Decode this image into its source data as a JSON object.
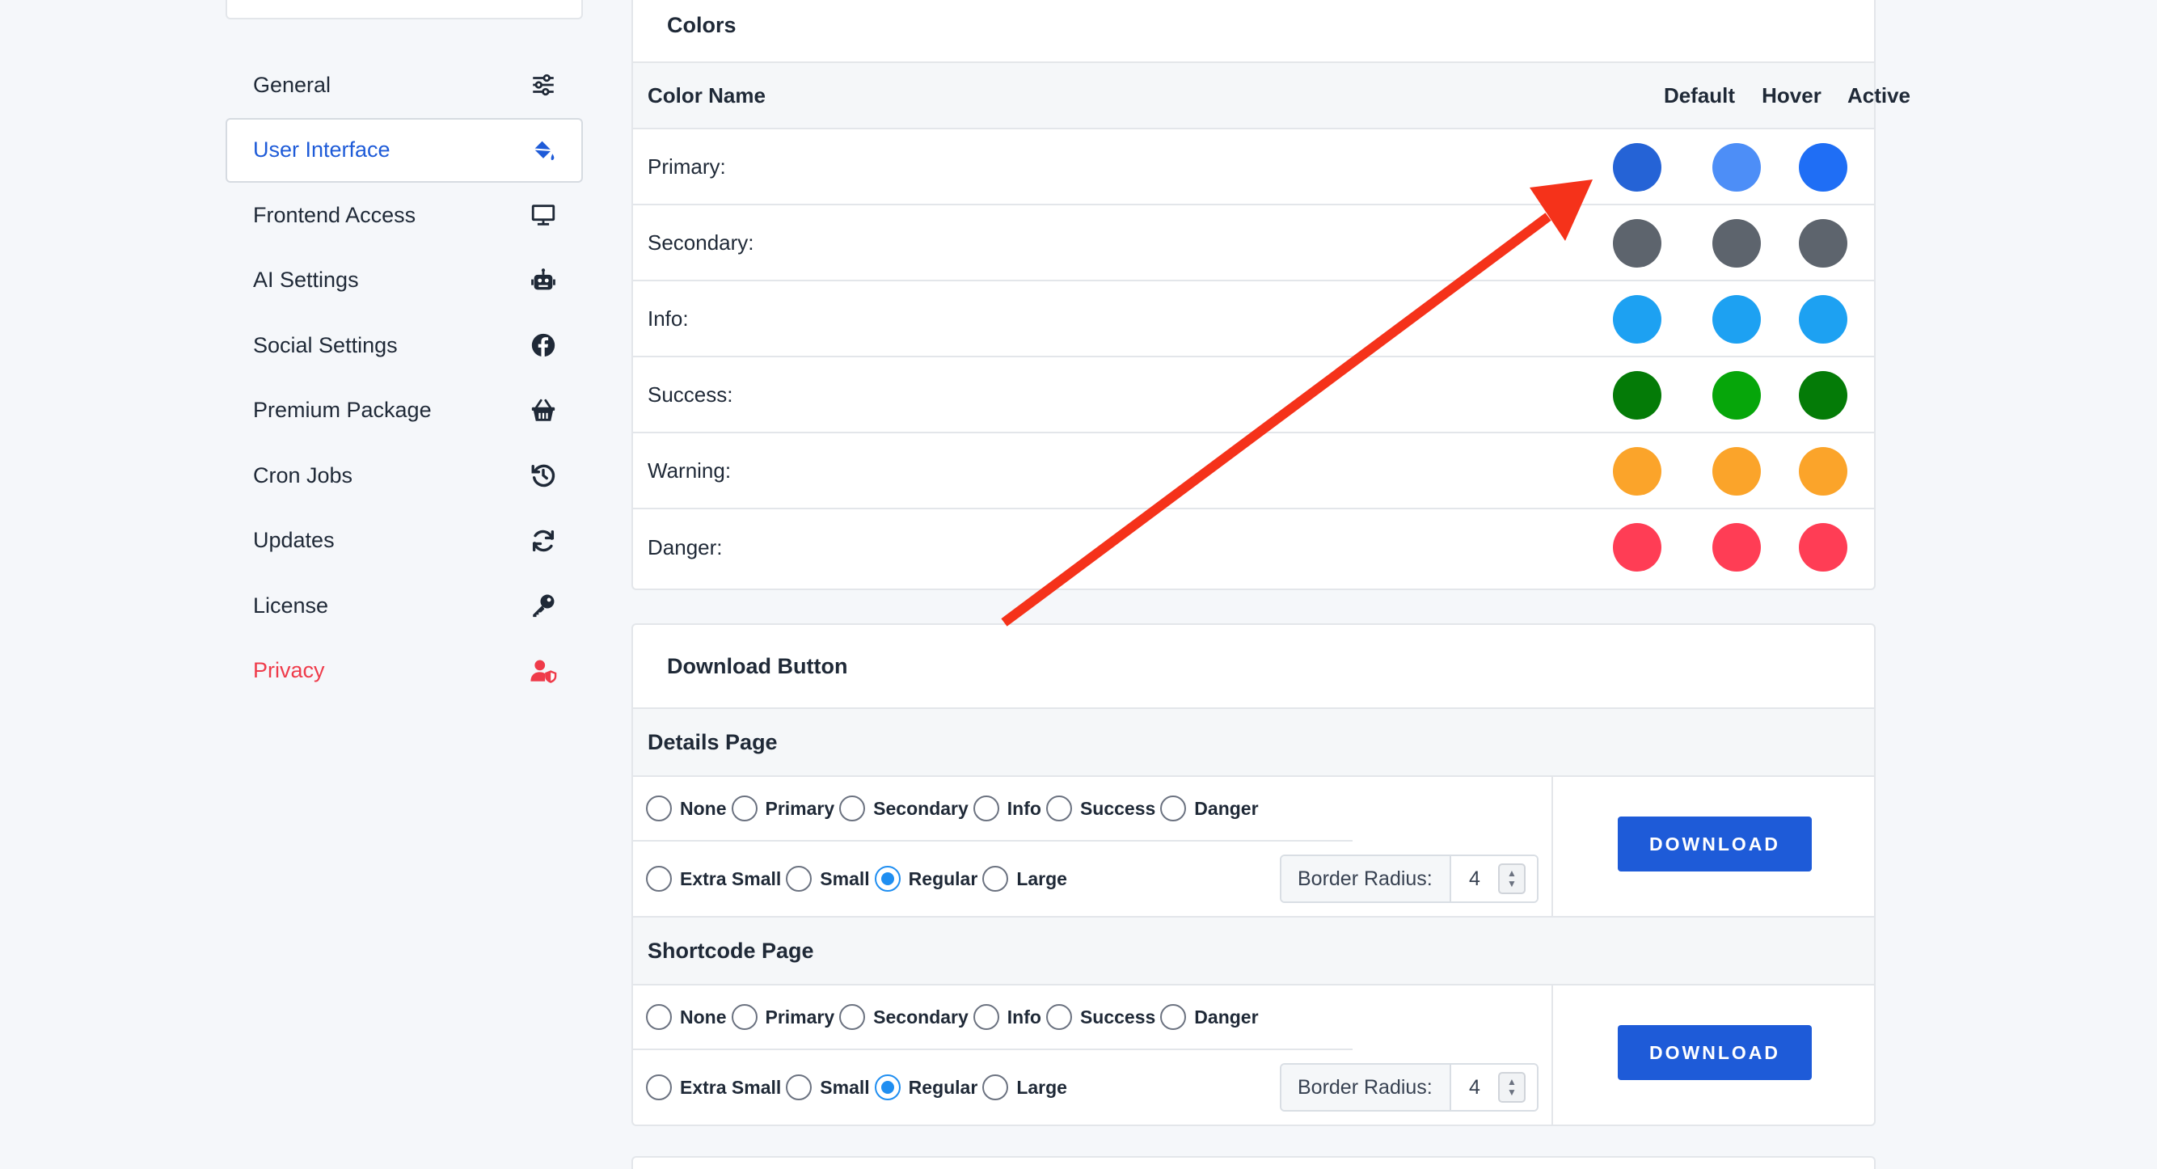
{
  "sidebar": {
    "items": [
      {
        "label": "General",
        "icon": "sliders-icon",
        "active": false,
        "danger": false
      },
      {
        "label": "User Interface",
        "icon": "paint-bucket-icon",
        "active": true,
        "danger": false
      },
      {
        "label": "Frontend Access",
        "icon": "monitor-icon",
        "active": false,
        "danger": false
      },
      {
        "label": "AI Settings",
        "icon": "robot-icon",
        "active": false,
        "danger": false
      },
      {
        "label": "Social Settings",
        "icon": "facebook-icon",
        "active": false,
        "danger": false
      },
      {
        "label": "Premium Package",
        "icon": "basket-icon",
        "active": false,
        "danger": false
      },
      {
        "label": "Cron Jobs",
        "icon": "history-icon",
        "active": false,
        "danger": false
      },
      {
        "label": "Updates",
        "icon": "sync-icon",
        "active": false,
        "danger": false
      },
      {
        "label": "License",
        "icon": "key-icon",
        "active": false,
        "danger": false
      },
      {
        "label": "Privacy",
        "icon": "user-shield-icon",
        "active": false,
        "danger": true
      }
    ]
  },
  "colors": {
    "title": "Colors",
    "headers": {
      "name": "Color Name",
      "default": "Default",
      "hover": "Hover",
      "active": "Active"
    },
    "rows": [
      {
        "label": "Primary:",
        "default": "#2563d6",
        "hover": "#4d8ef7",
        "active": "#1f6ef5"
      },
      {
        "label": "Secondary:",
        "default": "#5d646d",
        "hover": "#5d646d",
        "active": "#5d646d"
      },
      {
        "label": "Info:",
        "default": "#1da1f2",
        "hover": "#1da1f2",
        "active": "#1da1f2"
      },
      {
        "label": "Success:",
        "default": "#047b07",
        "hover": "#06a60a",
        "active": "#047b07"
      },
      {
        "label": "Warning:",
        "default": "#fba42a",
        "hover": "#fba42a",
        "active": "#fba42a"
      },
      {
        "label": "Danger:",
        "default": "#ff3d55",
        "hover": "#ff3d55",
        "active": "#ff3d55"
      }
    ]
  },
  "download": {
    "title": "Download Button",
    "sections": [
      {
        "heading": "Details Page",
        "styles": [
          "None",
          "Primary",
          "Secondary",
          "Info",
          "Success",
          "Danger"
        ],
        "selected_style": "",
        "sizes": [
          "Extra Small",
          "Small",
          "Regular",
          "Large"
        ],
        "selected_size": "Regular",
        "border_radius_label": "Border Radius:",
        "border_radius_value": "4",
        "button_label": "DOWNLOAD"
      },
      {
        "heading": "Shortcode Page",
        "styles": [
          "None",
          "Primary",
          "Secondary",
          "Info",
          "Success",
          "Danger"
        ],
        "selected_style": "",
        "sizes": [
          "Extra Small",
          "Small",
          "Regular",
          "Large"
        ],
        "selected_size": "Regular",
        "border_radius_label": "Border Radius:",
        "border_radius_value": "4",
        "button_label": "DOWNLOAD"
      }
    ]
  },
  "annotation": {
    "arrow_color": "#f5321a"
  },
  "accent": "#1e5bd8"
}
